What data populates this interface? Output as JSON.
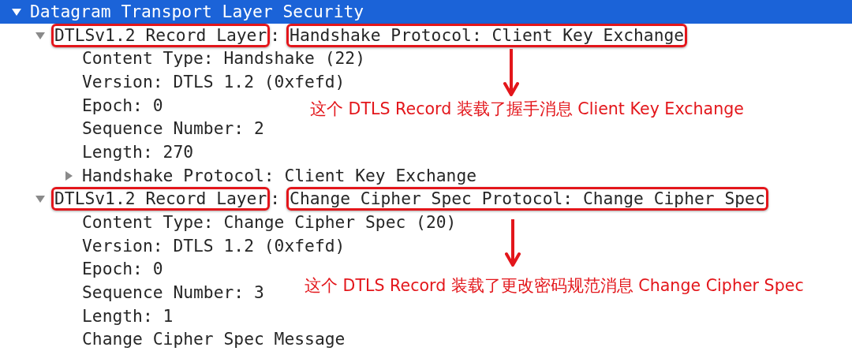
{
  "tree": [
    {
      "label_parts": [
        {
          "text": "Datagram Transport Layer Security",
          "boxed": false
        }
      ],
      "expanded": true,
      "selected": true,
      "children": [
        {
          "label_parts": [
            {
              "text": "DTLSv1.2 Record Layer",
              "boxed": true
            },
            {
              "text": ":",
              "boxed": false
            },
            {
              "text": "Handshake Protocol: Client Key Exchange",
              "boxed": true
            }
          ],
          "expanded": true,
          "selected": false,
          "children": [
            {
              "label_parts": [
                {
                  "text": "Content Type: Handshake (22)",
                  "boxed": false
                }
              ],
              "selected": false
            },
            {
              "label_parts": [
                {
                  "text": "Version: DTLS 1.2 (0xfefd)",
                  "boxed": false
                }
              ],
              "selected": false
            },
            {
              "label_parts": [
                {
                  "text": "Epoch: 0",
                  "boxed": false
                }
              ],
              "selected": false
            },
            {
              "label_parts": [
                {
                  "text": "Sequence Number: 2",
                  "boxed": false
                }
              ],
              "selected": false
            },
            {
              "label_parts": [
                {
                  "text": "Length: 270",
                  "boxed": false
                }
              ],
              "selected": false
            },
            {
              "label_parts": [
                {
                  "text": "Handshake Protocol: Client Key Exchange",
                  "boxed": false
                }
              ],
              "expanded": false,
              "selected": false
            }
          ]
        },
        {
          "label_parts": [
            {
              "text": "DTLSv1.2 Record Layer",
              "boxed": true
            },
            {
              "text": ":",
              "boxed": false
            },
            {
              "text": "Change Cipher Spec Protocol: Change Cipher Spec",
              "boxed": true
            }
          ],
          "expanded": true,
          "selected": false,
          "children": [
            {
              "label_parts": [
                {
                  "text": "Content Type: Change Cipher Spec (20)",
                  "boxed": false
                }
              ],
              "selected": false
            },
            {
              "label_parts": [
                {
                  "text": "Version: DTLS 1.2 (0xfefd)",
                  "boxed": false
                }
              ],
              "selected": false
            },
            {
              "label_parts": [
                {
                  "text": "Epoch: 0",
                  "boxed": false
                }
              ],
              "selected": false
            },
            {
              "label_parts": [
                {
                  "text": "Sequence Number: 3",
                  "boxed": false
                }
              ],
              "selected": false
            },
            {
              "label_parts": [
                {
                  "text": "Length: 1",
                  "boxed": false
                }
              ],
              "selected": false
            },
            {
              "label_parts": [
                {
                  "text": "Change Cipher Spec Message",
                  "boxed": false
                }
              ],
              "selected": false
            }
          ]
        }
      ]
    }
  ],
  "annotations": [
    {
      "text": "这个 DTLS Record 装载了握手消息 Client Key Exchange"
    },
    {
      "text": "这个 DTLS Record 装载了更改密码规范消息 Change Cipher Spec"
    }
  ]
}
